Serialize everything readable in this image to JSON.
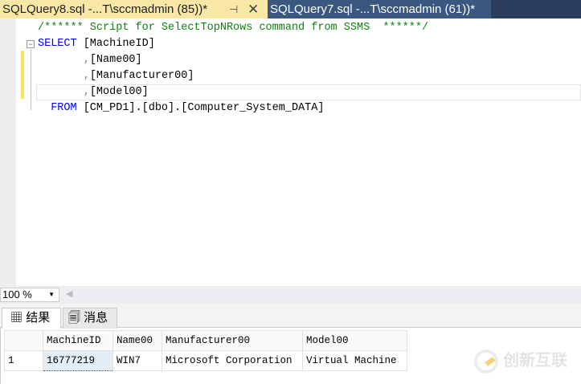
{
  "tabs": [
    {
      "label": "SQLQuery8.sql -...T\\sccmadmin (85))*",
      "pin": "⊣",
      "close": "✕"
    },
    {
      "label": "SQLQuery7.sql -...T\\sccmadmin (61))*"
    }
  ],
  "code": {
    "comment": "/****** Script for SelectTopNRows command from SSMS  ******/",
    "select_kw": "SELECT",
    "col1": " [MachineID]",
    "comma": ",",
    "col2": "[Name00]",
    "col3": "[Manufacturer00]",
    "col4": "[Model00]",
    "from_kw": "FROM",
    "from_rest": " [CM_PD1].[dbo].[Computer_System_DATA]"
  },
  "zoom": {
    "value": "100 %"
  },
  "result_tabs": {
    "results": "结果",
    "messages": "消息"
  },
  "grid": {
    "headers": [
      "MachineID",
      "Name00",
      "Manufacturer00",
      "Model00"
    ],
    "rows": [
      {
        "num": "1",
        "cells": [
          "16777219",
          "WIN7",
          "Microsoft Corporation",
          "Virtual Machine"
        ]
      }
    ]
  },
  "watermark": "创新互联"
}
